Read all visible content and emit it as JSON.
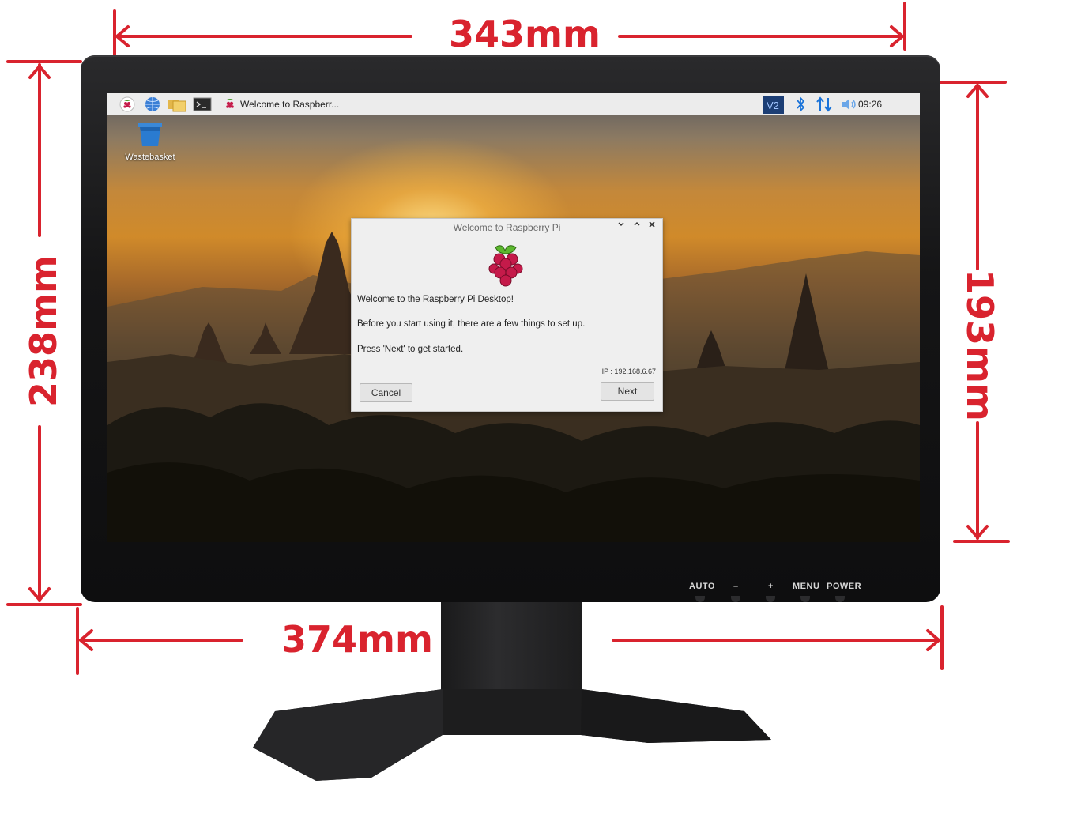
{
  "dimensions": {
    "top_width": "343mm",
    "left_height": "238mm",
    "right_height": "193mm",
    "bottom_width": "374mm"
  },
  "colors": {
    "annotation": "#d9232e",
    "bezel": "#151516",
    "taskbar": "#ececec",
    "dialog_bg": "#efefef"
  },
  "monitor": {
    "controls": [
      "AUTO",
      "–",
      "+",
      "MENU",
      "POWER"
    ]
  },
  "taskbar": {
    "launchers": [
      {
        "name": "raspberry-menu-icon"
      },
      {
        "name": "web-browser-icon"
      },
      {
        "name": "file-manager-icon"
      },
      {
        "name": "terminal-icon"
      }
    ],
    "window_title": "Welcome to Raspberr...",
    "tray": [
      "vnc-icon",
      "bluetooth-icon",
      "network-icon",
      "volume-icon"
    ],
    "vnc_label": "V2",
    "clock": "09:26"
  },
  "desktop": {
    "icons": [
      {
        "label": "Wastebasket",
        "icon": "trash-icon"
      }
    ]
  },
  "dialog": {
    "title": "Welcome to Raspberry Pi",
    "line1": "Welcome to the Raspberry Pi Desktop!",
    "line2": "Before you start using it, there are a few things to set up.",
    "line3": "Press 'Next' to get started.",
    "ip": "IP : 192.168.6.67",
    "cancel_label": "Cancel",
    "next_label": "Next",
    "window_controls": [
      "chevron-down-icon",
      "chevron-up-icon",
      "close-icon"
    ]
  }
}
